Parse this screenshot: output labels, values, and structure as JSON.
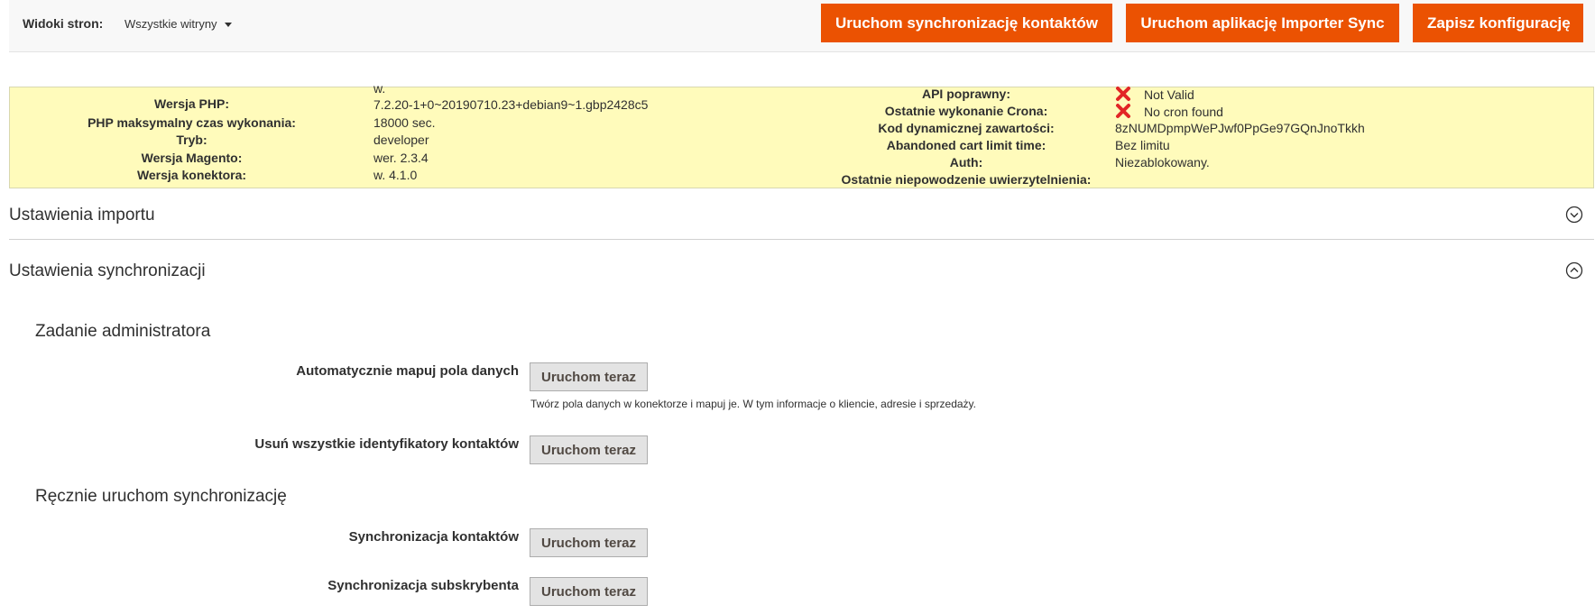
{
  "scope": {
    "label": "Widoki stron:",
    "selected": "Wszystkie witryny"
  },
  "actions": {
    "sync_contacts": "Uruchom synchronizację kontaktów",
    "importer_sync": "Uruchom aplikację Importer Sync",
    "save": "Zapisz konfigurację"
  },
  "info": {
    "php_version": {
      "label": "Wersja PHP:",
      "value_line1": "w.",
      "value_line2": "7.2.20-1+0~20190710.23+debian9~1.gbp2428c5"
    },
    "php_max_time": {
      "label": "PHP maksymalny czas wykonania:",
      "value": "18000 sec."
    },
    "mode": {
      "label": "Tryb:",
      "value": "developer"
    },
    "magento_version": {
      "label": "Wersja Magento:",
      "value": "wer. 2.3.4"
    },
    "connector_version": {
      "label": "Wersja konektora:",
      "value": "w. 4.1.0"
    },
    "api_valid": {
      "label": "API poprawny:",
      "value": "Not Valid"
    },
    "last_cron": {
      "label": "Ostatnie wykonanie Crona:",
      "value": "No cron found"
    },
    "dynamic_content": {
      "label": "Kod dynamicznej zawartości:",
      "value": "8zNUMDpmpWePJwf0PpGe97GQnJnoTkkh"
    },
    "abandoned_cart": {
      "label": "Abandoned cart limit time:",
      "value": "Bez limitu"
    },
    "auth": {
      "label": "Auth:",
      "value": "Niezablokowany."
    },
    "last_auth_failure": {
      "label": "Ostatnie niepowodzenie uwierzytelnienia:",
      "value": ""
    }
  },
  "sections": {
    "import": {
      "title": "Ustawienia importu"
    },
    "sync": {
      "title": "Ustawienia synchronizacji"
    }
  },
  "admin_task": {
    "title": "Zadanie administratora",
    "auto_map": {
      "label": "Automatycznie mapuj pola danych",
      "button": "Uruchom teraz",
      "note": "Twórz pola danych w konektorze i mapuj je. W tym informacje o kliencie, adresie i sprzedaży."
    },
    "remove_ids": {
      "label": "Usuń wszystkie identyfikatory kontaktów",
      "button": "Uruchom teraz"
    }
  },
  "manual_sync": {
    "title": "Ręcznie uruchom synchronizację",
    "contacts": {
      "label": "Synchronizacja kontaktów",
      "button": "Uruchom teraz"
    },
    "subscribers": {
      "label": "Synchronizacja subskrybenta",
      "button": "Uruchom teraz"
    }
  },
  "colors": {
    "accent": "#eb5202",
    "info_bg": "#fffbbb",
    "error": "#e22626"
  },
  "icons": {
    "error": "x-icon",
    "expand": "chevron-down-circle-icon",
    "collapse": "chevron-up-circle-icon"
  }
}
